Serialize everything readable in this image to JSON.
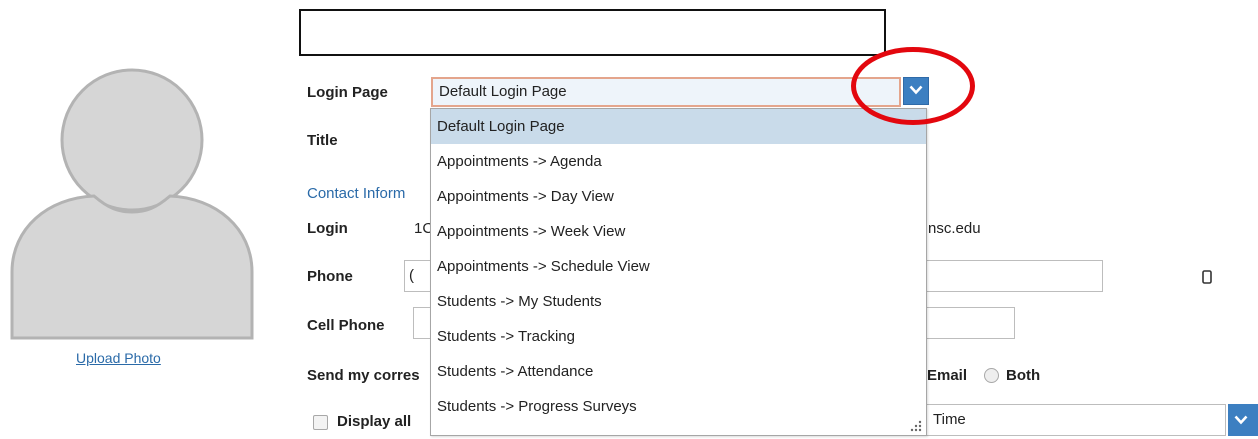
{
  "profile": {
    "upload_photo": "Upload Photo"
  },
  "form": {
    "login_page_label": "Login Page",
    "login_page_value": "Default Login Page",
    "title_label": "Title",
    "contact_heading": "Contact Inform",
    "login_label": "Login",
    "login_value_start": "1C",
    "login_value_end": "nsc.edu",
    "phone_label": "Phone",
    "phone_value_start": "(",
    "cell_phone_label": "Cell Phone",
    "send_label": "Send my corres",
    "email_option": "Email",
    "both_option": "Both",
    "display_label": "Display all",
    "time_select_value": "Time"
  },
  "dropdown": {
    "options": [
      "Default Login Page",
      "Appointments -> Agenda",
      "Appointments -> Day View",
      "Appointments -> Week View",
      "Appointments -> Schedule View",
      "Students -> My Students",
      "Students -> Tracking",
      "Students -> Attendance",
      "Students -> Progress Surveys"
    ],
    "selected_index": 0
  },
  "colors": {
    "accent_blue": "#3c7fc1",
    "link_blue": "#2a6aa8",
    "annotation_red": "#e3070e",
    "selected_bg": "#c9dbea",
    "focus_border": "#e4a58c"
  },
  "icons": {
    "dropdown_arrow": "chevron-down-icon",
    "phone_device": "mobile-phone-icon",
    "avatar": "user-placeholder-icon",
    "resize": "resize-grip-icon"
  }
}
